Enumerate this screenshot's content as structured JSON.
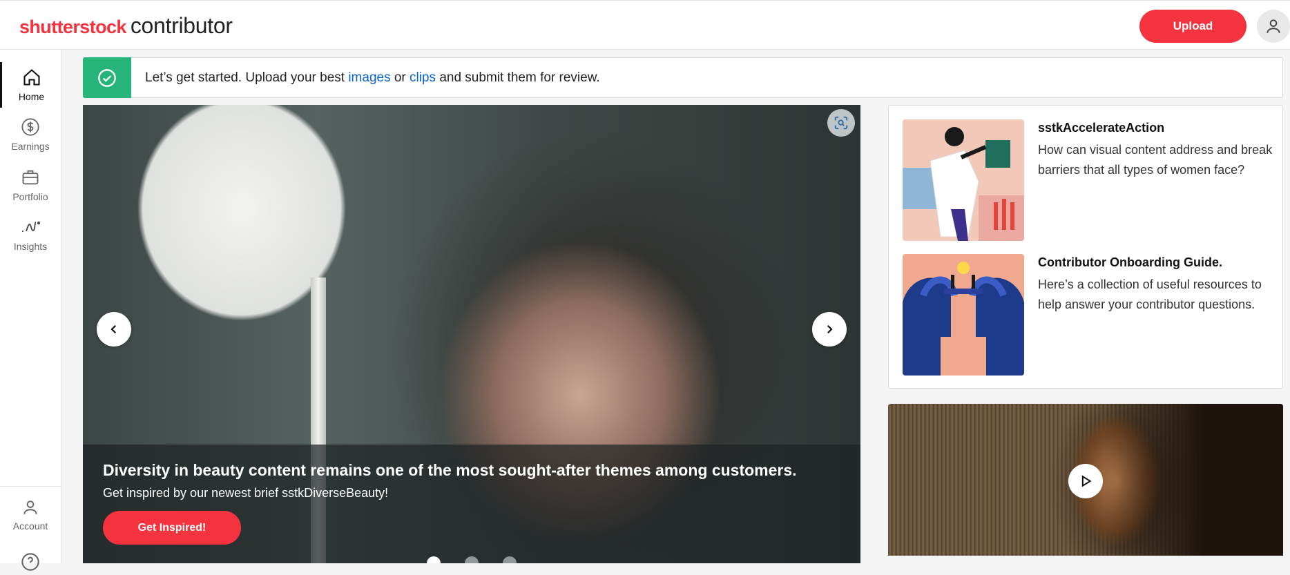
{
  "header": {
    "brand": "shutterstock",
    "product": "contributor",
    "upload_label": "Upload",
    "account_icon": "person-icon"
  },
  "sidebar": {
    "items": [
      {
        "label": "Home",
        "icon": "home-icon",
        "active": true
      },
      {
        "label": "Earnings",
        "icon": "dollar-icon"
      },
      {
        "label": "Portfolio",
        "icon": "briefcase-icon"
      },
      {
        "label": "Insights",
        "icon": "insights-icon"
      }
    ],
    "bottom_items": [
      {
        "label": "Account",
        "icon": "person-icon"
      },
      {
        "label": "",
        "icon": "help-icon"
      }
    ]
  },
  "banner": {
    "text_before": "Let’s get started. Upload your best ",
    "link_images": "images",
    "text_middle": " or ",
    "link_clips": "clips",
    "text_after": " and submit them for review."
  },
  "hero": {
    "title": "Diversity in beauty content remains one of the most sought-after themes among customers.",
    "subtitle": "Get inspired by our newest brief sstkDiverseBeauty!",
    "cta_label": "Get Inspired!",
    "slide_count": 3,
    "active_slide": 1
  },
  "articles": [
    {
      "title": "sstkAccelerateAction",
      "description": "How can visual content address and break barriers that all types of women face?"
    },
    {
      "title": "Contributor Onboarding Guide.",
      "description": "Here’s a collection of useful resources to help answer your contributor questions."
    }
  ],
  "colors": {
    "brand_red": "#f5333f",
    "success_green": "#27b47a",
    "link_blue": "#0b63ce"
  }
}
